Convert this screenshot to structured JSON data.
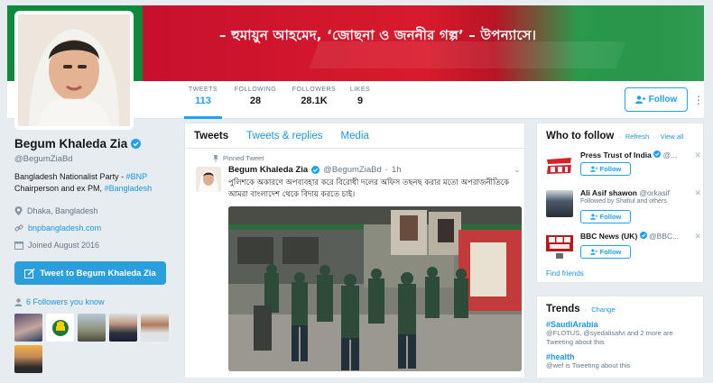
{
  "banner": {
    "text": "– হুমায়ুন আহমেদ, ‘জোছনা ও জননীর গল্প’ – উপন্যাসে।"
  },
  "stats": [
    {
      "label": "TWEETS",
      "value": "113"
    },
    {
      "label": "FOLLOWING",
      "value": "28"
    },
    {
      "label": "FOLLOWERS",
      "value": "28.1K"
    },
    {
      "label": "LIKES",
      "value": "9"
    }
  ],
  "header": {
    "follow_label": "Follow"
  },
  "profile": {
    "name": "Begum Khaleda Zia",
    "handle": "@BegumZiaBd",
    "bio_prefix": "Bangladesh Nationalist Party - ",
    "bio_tag1": "#BNP",
    "bio_middle": "Chairperson and ex PM, ",
    "bio_tag2": "#Bangladesh",
    "location": "Dhaka, Bangladesh",
    "website": "bnpbangladesh.com",
    "joined": "Joined August 2016",
    "tweet_to_label": "Tweet to Begum Khaleda Zia",
    "followers_you_know": "6 Followers you know"
  },
  "timeline": {
    "tabs": [
      "Tweets",
      "Tweets & replies",
      "Media"
    ],
    "pinned_label": "Pinned Tweet",
    "tweet": {
      "name": "Begum Khaleda Zia",
      "handle": "@BegumZiaBd",
      "time": "1h",
      "text_line1": "পুলিশকে অকারণে অপব্যবহার করে বিরোধী দলের অফিস তছনছ করার মতো অপরাজনীতিকে",
      "text_line2": "আমরা বাংলাদেশ থেকে বিদায় করতে চাই।"
    }
  },
  "who_to_follow": {
    "title": "Who to follow",
    "refresh": "Refresh",
    "view_all": "View all",
    "follow_label": "Follow",
    "items": [
      {
        "name": "Press Trust of India",
        "handle": "@...",
        "sub": ""
      },
      {
        "name": "Ali Asif shawon",
        "handle": "@orkasif",
        "sub": "Followed by Shafiul and others"
      },
      {
        "name": "BBC News (UK)",
        "handle": "@BBC...",
        "sub": ""
      }
    ],
    "find_friends": "Find friends"
  },
  "trends": {
    "title": "Trends",
    "change": "Change",
    "items": [
      {
        "tag": "#SaudiArabia",
        "desc": "@FLOTUS, @syedalisafvi and 2 more are Tweeting about this"
      },
      {
        "tag": "#health",
        "desc": "@wef is Tweeting about this"
      }
    ]
  },
  "colors": {
    "accent": "#1da1f2",
    "link": "#1b95e0",
    "banner_red": "#d81b2c",
    "banner_green": "#0e8a3f"
  }
}
